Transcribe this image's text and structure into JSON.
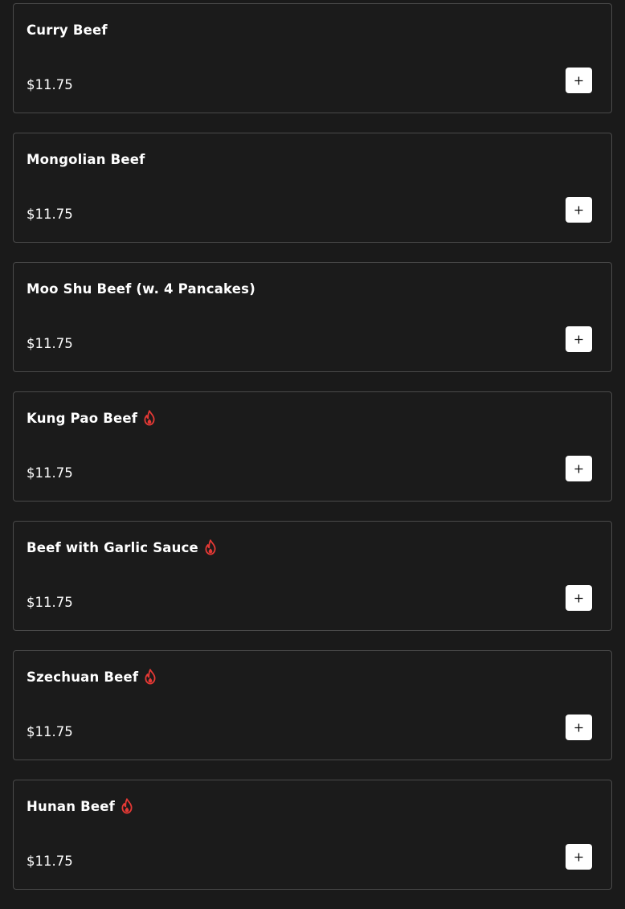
{
  "colors": {
    "background": "#1a1a1a",
    "card_border": "#4a4a4a",
    "text": "#ffffff",
    "spicy": "#e53935",
    "button": "#ffffff"
  },
  "add_button_icon": "plus-icon",
  "items": [
    {
      "name": "Curry Beef",
      "price": "$11.75",
      "spicy": false
    },
    {
      "name": "Mongolian Beef",
      "price": "$11.75",
      "spicy": false
    },
    {
      "name": "Moo Shu Beef (w. 4 Pancakes)",
      "price": "$11.75",
      "spicy": false
    },
    {
      "name": "Kung Pao Beef",
      "price": "$11.75",
      "spicy": true
    },
    {
      "name": "Beef with Garlic Sauce",
      "price": "$11.75",
      "spicy": true
    },
    {
      "name": "Szechuan Beef",
      "price": "$11.75",
      "spicy": true
    },
    {
      "name": "Hunan Beef",
      "price": "$11.75",
      "spicy": true
    }
  ]
}
